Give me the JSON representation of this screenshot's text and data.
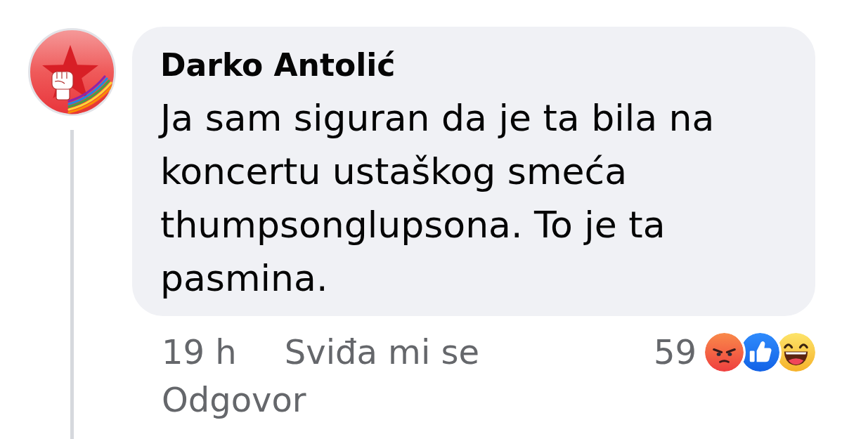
{
  "comment": {
    "author": "Darko Antolić",
    "text": "Ja sam siguran da je ta bila na koncertu ustaškog smeća thumpsonglupsona. To je ta pasmina.",
    "time": "19 h",
    "actions": [
      "Sviđa mi se",
      "Odgovor"
    ],
    "reaction_count": "59"
  }
}
